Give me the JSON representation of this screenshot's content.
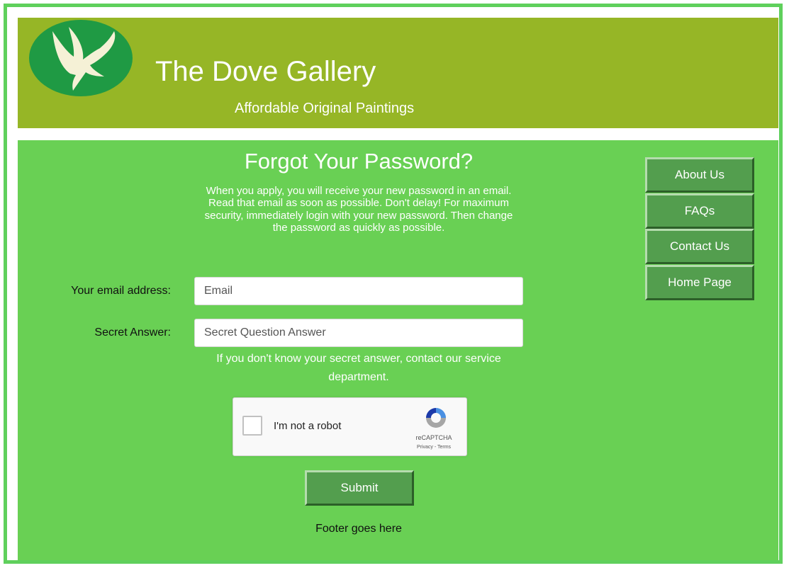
{
  "header": {
    "title": "The Dove Gallery",
    "subtitle": "Affordable Original Paintings",
    "logo_icon": "dove-logo-icon"
  },
  "colors": {
    "frame": "#5fd05c",
    "header_bg": "#96b626",
    "content_bg": "#69d054",
    "logo_bg": "#1f9a44",
    "button_bg": "#539e4e"
  },
  "form": {
    "title": "Forgot Your Password?",
    "intro": "When you apply, you will receive your new password in an email. Read that email as soon as possible. Don't delay! For maximum security, immediately login with your new password. Then change the password as quickly as possible.",
    "email_label": "Your email address:",
    "email_placeholder": "Email",
    "email_value": "",
    "secret_label": "Secret Answer:",
    "secret_placeholder": "Secret Question Answer",
    "secret_value": "",
    "hint": "If you don't know your secret answer, contact our service department.",
    "recaptcha": {
      "label": "I'm not a robot",
      "brand": "reCAPTCHA",
      "links": "Privacy - Terms",
      "icon": "recaptcha-logo-icon"
    },
    "submit_label": "Submit"
  },
  "nav": {
    "items": [
      {
        "label": "About Us"
      },
      {
        "label": "FAQs"
      },
      {
        "label": "Contact Us"
      },
      {
        "label": "Home Page"
      }
    ]
  },
  "footer": {
    "text": "Footer goes here"
  }
}
